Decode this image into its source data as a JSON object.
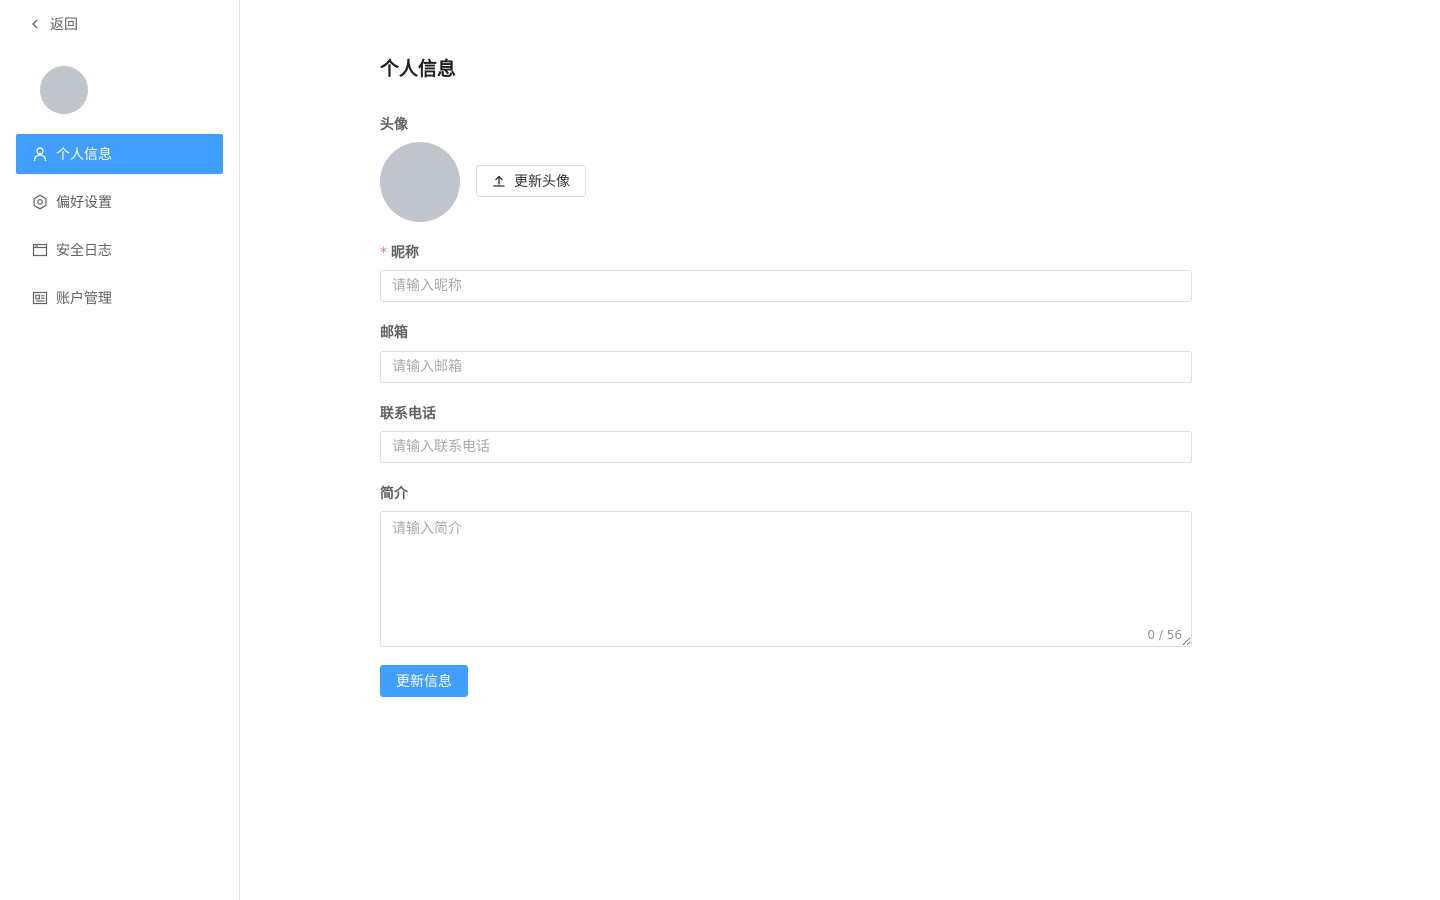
{
  "sidebar": {
    "back_label": "返回",
    "back_icon": "chevron-left-icon",
    "menu": [
      {
        "label": "个人信息",
        "icon": "user-icon",
        "active": true
      },
      {
        "label": "偏好设置",
        "icon": "gear-icon",
        "active": false
      },
      {
        "label": "安全日志",
        "icon": "browser-window-icon",
        "active": false
      },
      {
        "label": "账户管理",
        "icon": "id-card-icon",
        "active": false
      }
    ]
  },
  "main": {
    "title": "个人信息",
    "avatar": {
      "label": "头像",
      "upload_label": "更新头像",
      "upload_icon": "upload-icon"
    },
    "nickname": {
      "label": "昵称",
      "required": true,
      "placeholder": "请输入昵称",
      "value": ""
    },
    "email": {
      "label": "邮箱",
      "placeholder": "请输入邮箱",
      "value": ""
    },
    "phone": {
      "label": "联系电话",
      "placeholder": "请输入联系电话",
      "value": ""
    },
    "bio": {
      "label": "简介",
      "placeholder": "请输入简介",
      "value": "",
      "counter": "0 / 56"
    },
    "submit_label": "更新信息"
  },
  "colors": {
    "primary": "#409eff",
    "required": "#f56c6c",
    "avatar_placeholder": "#c0c4cc",
    "border": "#dcdfe6"
  }
}
